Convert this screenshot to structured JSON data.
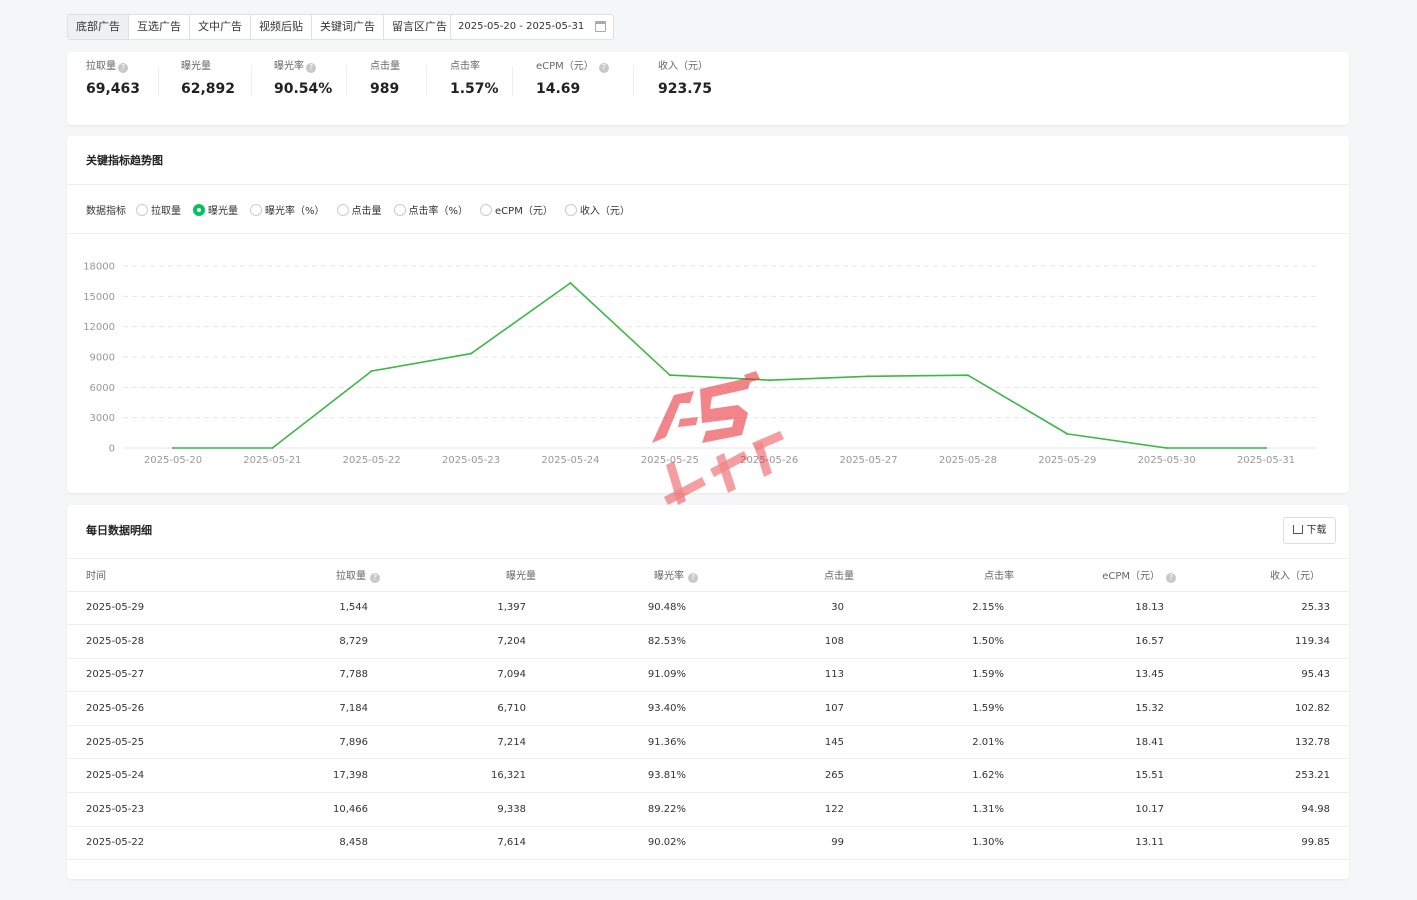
{
  "tabs": [
    "底部广告",
    "互选广告",
    "文中广告",
    "视频后贴",
    "关键词广告",
    "留言区广告"
  ],
  "date_range": "2025-05-20 - 2025-05-31",
  "summary": [
    {
      "label": "拉取量",
      "value": "69,463",
      "help": true
    },
    {
      "label": "曝光量",
      "value": "62,892",
      "help": false
    },
    {
      "label": "曝光率",
      "value": "90.54%",
      "help": true
    },
    {
      "label": "点击量",
      "value": "989",
      "help": false
    },
    {
      "label": "点击率",
      "value": "1.57%",
      "help": false
    },
    {
      "label": "eCPM（元）",
      "value": "14.69",
      "help": true
    },
    {
      "label": "收入（元）",
      "value": "923.75",
      "help": false
    }
  ],
  "trend": {
    "title": "关键指标趋势图",
    "metric_label": "数据指标",
    "options": [
      "拉取量",
      "曝光量",
      "曝光率（%）",
      "点击量",
      "点击率（%）",
      "eCPM（元）",
      "收入（元）"
    ],
    "selected": "曝光量"
  },
  "chart_data": {
    "type": "line",
    "x": [
      "2025-05-20",
      "2025-05-21",
      "2025-05-22",
      "2025-05-23",
      "2025-05-24",
      "2025-05-25",
      "2025-05-26",
      "2025-05-27",
      "2025-05-28",
      "2025-05-29",
      "2025-05-30",
      "2025-05-31"
    ],
    "series": [
      {
        "values": [
          0,
          0,
          7614,
          9338,
          16321,
          7214,
          6710,
          7094,
          7204,
          1397,
          0,
          0
        ],
        "color": "#3cb846"
      }
    ],
    "yticks": [
      "18000",
      "15000",
      "12000",
      "9000",
      "6000",
      "3000",
      "0"
    ],
    "ylim": [
      0,
      18000
    ],
    "grid": true
  },
  "details": {
    "title": "每日数据明细",
    "download_label": "下载",
    "headers": [
      "时间",
      "拉取量",
      "曝光量",
      "曝光率",
      "点击量",
      "点击率",
      "eCPM（元）",
      "收入（元）"
    ],
    "rows": [
      [
        "2025-05-29",
        "1,544",
        "1,397",
        "90.48%",
        "30",
        "2.15%",
        "18.13",
        "25.33"
      ],
      [
        "2025-05-28",
        "8,729",
        "7,204",
        "82.53%",
        "108",
        "1.50%",
        "16.57",
        "119.34"
      ],
      [
        "2025-05-27",
        "7,788",
        "7,094",
        "91.09%",
        "113",
        "1.59%",
        "13.45",
        "95.43"
      ],
      [
        "2025-05-26",
        "7,184",
        "6,710",
        "93.40%",
        "107",
        "1.59%",
        "15.32",
        "102.82"
      ],
      [
        "2025-05-25",
        "7,896",
        "7,214",
        "91.36%",
        "145",
        "2.01%",
        "18.41",
        "132.78"
      ],
      [
        "2025-05-24",
        "17,398",
        "16,321",
        "93.81%",
        "265",
        "1.62%",
        "15.51",
        "253.21"
      ],
      [
        "2025-05-23",
        "10,466",
        "9,338",
        "89.22%",
        "122",
        "1.31%",
        "10.17",
        "94.98"
      ],
      [
        "2025-05-22",
        "8,458",
        "7,614",
        "90.02%",
        "99",
        "1.30%",
        "13.11",
        "99.85"
      ]
    ]
  },
  "watermark": {
    "brand": "A5",
    "text": "新媒体"
  }
}
